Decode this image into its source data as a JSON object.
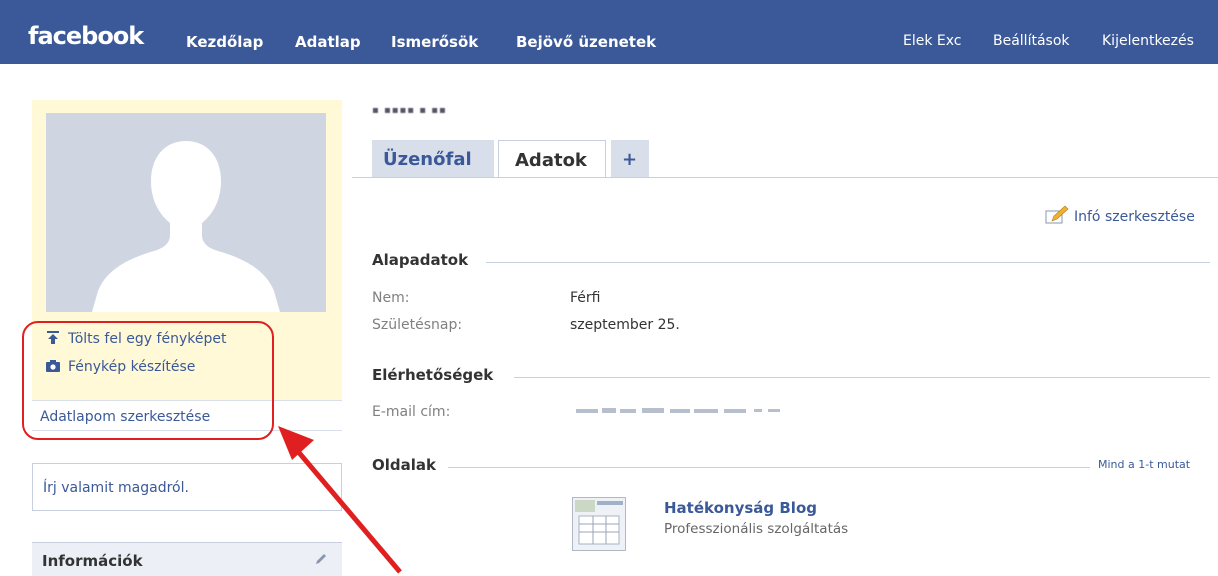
{
  "nav": {
    "logo": "facebook",
    "links": [
      "Kezdőlap",
      "Adatlap",
      "Ismerősök",
      "Bejövő üzenetek"
    ],
    "right": [
      "Elek Exc",
      "Beállítások",
      "Kijelentkezés"
    ]
  },
  "profile": {
    "upload_photo": "Tölts fel egy fényképet",
    "take_photo": "Fénykép készítése",
    "edit_profile": "Adatlapom szerkesztése",
    "about_placeholder": "Írj valamit magadról.",
    "info_header": "Információk"
  },
  "tabs": {
    "wall": "Üzenőfal",
    "info": "Adatok",
    "add": "+"
  },
  "info": {
    "edit_link": "Infó szerkesztése",
    "basic": {
      "header": "Alapadatok",
      "rows": [
        {
          "label": "Nem:",
          "value": "Férfi"
        },
        {
          "label": "Születésnap:",
          "value": "szeptember 25."
        }
      ]
    },
    "contact": {
      "header": "Elérhetőségek",
      "email_label": "E-mail cím:"
    },
    "pages": {
      "header": "Oldalak",
      "show_all": "Mind a 1-t mutat",
      "items": [
        {
          "title": "Hatékonyság Blog",
          "subtitle": "Professzionális szolgáltatás"
        }
      ]
    }
  },
  "colors": {
    "brand": "#3b5998",
    "panel": "#fff9d7",
    "annotation": "#e02020"
  }
}
